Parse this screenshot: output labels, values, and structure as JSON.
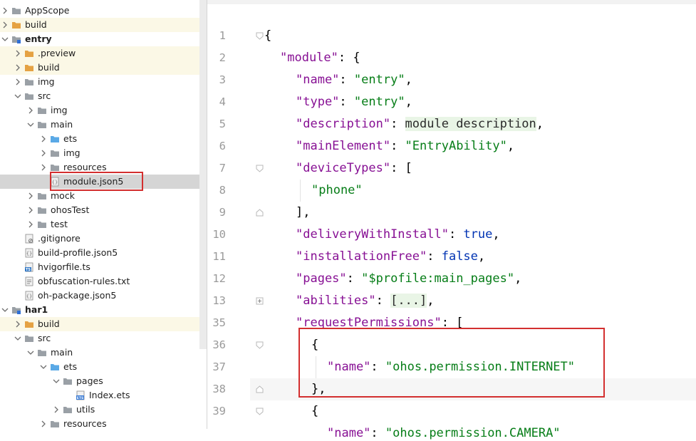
{
  "project_tree": [
    {
      "label": "AppScope",
      "kind": "folder-gray",
      "depth": 0,
      "expanded": false,
      "bold": false
    },
    {
      "label": "build",
      "kind": "folder-orange",
      "depth": 0,
      "expanded": false,
      "bold": false,
      "row": "yellow"
    },
    {
      "label": "entry",
      "kind": "folder-module",
      "depth": 0,
      "expanded": true,
      "bold": true
    },
    {
      "label": ".preview",
      "kind": "folder-orange",
      "depth": 1,
      "expanded": false,
      "bold": false,
      "row": "yellow"
    },
    {
      "label": "build",
      "kind": "folder-orange",
      "depth": 1,
      "expanded": false,
      "bold": false,
      "row": "yellow"
    },
    {
      "label": "img",
      "kind": "folder-gray",
      "depth": 1,
      "expanded": false,
      "bold": false
    },
    {
      "label": "src",
      "kind": "folder-gray",
      "depth": 1,
      "expanded": true,
      "bold": false
    },
    {
      "label": "img",
      "kind": "folder-gray",
      "depth": 2,
      "expanded": false,
      "bold": false
    },
    {
      "label": "main",
      "kind": "folder-gray",
      "depth": 2,
      "expanded": true,
      "bold": false
    },
    {
      "label": "ets",
      "kind": "folder-blue",
      "depth": 3,
      "expanded": false,
      "bold": false
    },
    {
      "label": "img",
      "kind": "folder-gray",
      "depth": 3,
      "expanded": false,
      "bold": false
    },
    {
      "label": "resources",
      "kind": "folder-gray",
      "depth": 3,
      "expanded": false,
      "bold": false
    },
    {
      "label": "module.json5",
      "kind": "file-json",
      "depth": 3,
      "leaf": true,
      "bold": false,
      "row": "selected"
    },
    {
      "label": "mock",
      "kind": "folder-gray",
      "depth": 2,
      "expanded": false,
      "bold": false
    },
    {
      "label": "ohosTest",
      "kind": "folder-gray",
      "depth": 2,
      "expanded": false,
      "bold": false
    },
    {
      "label": "test",
      "kind": "folder-gray",
      "depth": 2,
      "expanded": false,
      "bold": false
    },
    {
      "label": ".gitignore",
      "kind": "file-gitignore",
      "depth": 1,
      "leaf": true,
      "bold": false
    },
    {
      "label": "build-profile.json5",
      "kind": "file-json",
      "depth": 1,
      "leaf": true,
      "bold": false
    },
    {
      "label": "hvigorfile.ts",
      "kind": "file-ts",
      "depth": 1,
      "leaf": true,
      "bold": false
    },
    {
      "label": "obfuscation-rules.txt",
      "kind": "file-txt",
      "depth": 1,
      "leaf": true,
      "bold": false
    },
    {
      "label": "oh-package.json5",
      "kind": "file-json",
      "depth": 1,
      "leaf": true,
      "bold": false
    },
    {
      "label": "har1",
      "kind": "folder-module",
      "depth": 0,
      "expanded": true,
      "bold": true
    },
    {
      "label": "build",
      "kind": "folder-orange",
      "depth": 1,
      "expanded": false,
      "bold": false,
      "row": "yellow"
    },
    {
      "label": "src",
      "kind": "folder-gray",
      "depth": 1,
      "expanded": true,
      "bold": false
    },
    {
      "label": "main",
      "kind": "folder-gray",
      "depth": 2,
      "expanded": true,
      "bold": false
    },
    {
      "label": "ets",
      "kind": "folder-blue",
      "depth": 3,
      "expanded": true,
      "bold": false
    },
    {
      "label": "pages",
      "kind": "folder-gray",
      "depth": 4,
      "expanded": true,
      "bold": false
    },
    {
      "label": "Index.ets",
      "kind": "file-ets",
      "depth": 5,
      "leaf": true,
      "bold": false
    },
    {
      "label": "utils",
      "kind": "folder-gray",
      "depth": 4,
      "expanded": false,
      "bold": false
    },
    {
      "label": "resources",
      "kind": "folder-gray",
      "depth": 3,
      "expanded": false,
      "bold": false
    }
  ],
  "editor": {
    "lines": [
      {
        "num": "1",
        "tokens": [
          [
            "p",
            "{"
          ]
        ],
        "indent": 0,
        "fold": "open"
      },
      {
        "num": "2",
        "tokens": [
          [
            "k",
            "\"module\""
          ],
          [
            "p",
            ": {"
          ]
        ],
        "indent": 1
      },
      {
        "num": "3",
        "tokens": [
          [
            "k",
            "\"name\""
          ],
          [
            "p",
            ": "
          ],
          [
            "s",
            "\"entry\""
          ],
          [
            "p",
            ","
          ]
        ],
        "indent": 2
      },
      {
        "num": "4",
        "tokens": [
          [
            "k",
            "\"type\""
          ],
          [
            "p",
            ": "
          ],
          [
            "s",
            "\"entry\""
          ],
          [
            "p",
            ","
          ]
        ],
        "indent": 2
      },
      {
        "num": "5",
        "tokens": [
          [
            "k",
            "\"description\""
          ],
          [
            "p",
            ": "
          ],
          [
            "hl",
            "module description"
          ],
          [
            "p",
            ","
          ]
        ],
        "indent": 2
      },
      {
        "num": "6",
        "tokens": [
          [
            "k",
            "\"mainElement\""
          ],
          [
            "p",
            ": "
          ],
          [
            "s",
            "\"EntryAbility\""
          ],
          [
            "p",
            ","
          ]
        ],
        "indent": 2
      },
      {
        "num": "7",
        "tokens": [
          [
            "k",
            "\"deviceTypes\""
          ],
          [
            "p",
            ": ["
          ]
        ],
        "indent": 2,
        "fold": "open"
      },
      {
        "num": "8",
        "tokens": [
          [
            "s",
            "\"phone\""
          ]
        ],
        "indent": 3
      },
      {
        "num": "9",
        "tokens": [
          [
            "p",
            "],"
          ]
        ],
        "indent": 2,
        "fold": "close"
      },
      {
        "num": "10",
        "tokens": [
          [
            "k",
            "\"deliveryWithInstall\""
          ],
          [
            "p",
            ": "
          ],
          [
            "b",
            "true"
          ],
          [
            "p",
            ","
          ]
        ],
        "indent": 2
      },
      {
        "num": "11",
        "tokens": [
          [
            "k",
            "\"installationFree\""
          ],
          [
            "p",
            ": "
          ],
          [
            "b",
            "false"
          ],
          [
            "p",
            ","
          ]
        ],
        "indent": 2
      },
      {
        "num": "12",
        "tokens": [
          [
            "k",
            "\"pages\""
          ],
          [
            "p",
            ": "
          ],
          [
            "s",
            "\"$profile:main_pages\""
          ],
          [
            "p",
            ","
          ]
        ],
        "indent": 2
      },
      {
        "num": "13",
        "tokens": [
          [
            "k",
            "\"abilities\""
          ],
          [
            "p",
            ": "
          ],
          [
            "hl",
            "[...]"
          ],
          [
            "p",
            ","
          ]
        ],
        "indent": 2,
        "fold": "plus"
      },
      {
        "num": "35",
        "tokens": [
          [
            "k",
            "\"requestPermissions\""
          ],
          [
            "p",
            ": ["
          ]
        ],
        "indent": 2
      },
      {
        "num": "36",
        "tokens": [
          [
            "p",
            "{"
          ]
        ],
        "indent": 3,
        "fold": "open"
      },
      {
        "num": "37",
        "tokens": [
          [
            "k",
            "\"name\""
          ],
          [
            "p",
            ": "
          ],
          [
            "s",
            "\"ohos.permission.INTERNET\""
          ]
        ],
        "indent": 4
      },
      {
        "num": "38",
        "tokens": [
          [
            "p",
            "},"
          ]
        ],
        "indent": 3,
        "fold": "close",
        "current": true
      },
      {
        "num": "39",
        "tokens": [
          [
            "p",
            "{"
          ]
        ],
        "indent": 3,
        "fold": "open"
      },
      {
        "num": "",
        "tokens": [
          [
            "k",
            "\"name\""
          ],
          [
            "p",
            ": "
          ],
          [
            "s",
            "\"ohos.permission.CAMERA\""
          ]
        ],
        "indent": 4
      }
    ]
  },
  "colors": {
    "key": "#871094",
    "string": "#067d17",
    "keyword": "#0033b3",
    "highlight_box": "#d32f2f"
  }
}
